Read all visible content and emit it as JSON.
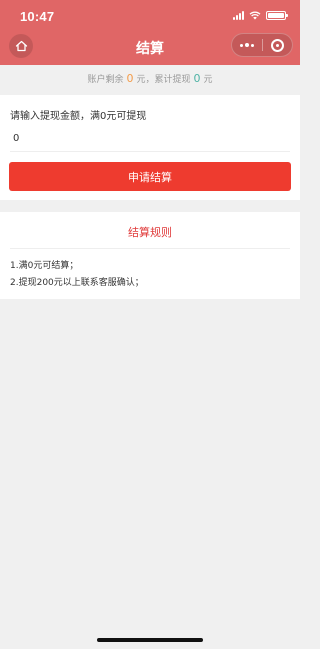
{
  "status_bar": {
    "time": "10:47"
  },
  "nav": {
    "title": "结算"
  },
  "summary": {
    "balance_label": "账户剩余",
    "balance_value": "0",
    "balance_unit": "元，累计提现",
    "withdrawn_value": "0",
    "withdrawn_unit": "元"
  },
  "withdraw": {
    "label": "请输入提现金额，满0元可提现",
    "input_value": "0",
    "submit_label": "申请结算"
  },
  "rules": {
    "title": "结算规则",
    "items": [
      "1.满0元可结算；",
      "2.提现200元以上联系客服确认；"
    ]
  },
  "colors": {
    "header": "#e06666",
    "button": "#ee3b2f",
    "rules_title": "#e03b3b",
    "balance_value": "#f39c4b",
    "withdrawn_value": "#4fb3a5"
  },
  "icons": [
    "home-icon",
    "more-dots-icon",
    "close-target-icon",
    "signal-icon",
    "wifi-icon",
    "battery-icon"
  ]
}
